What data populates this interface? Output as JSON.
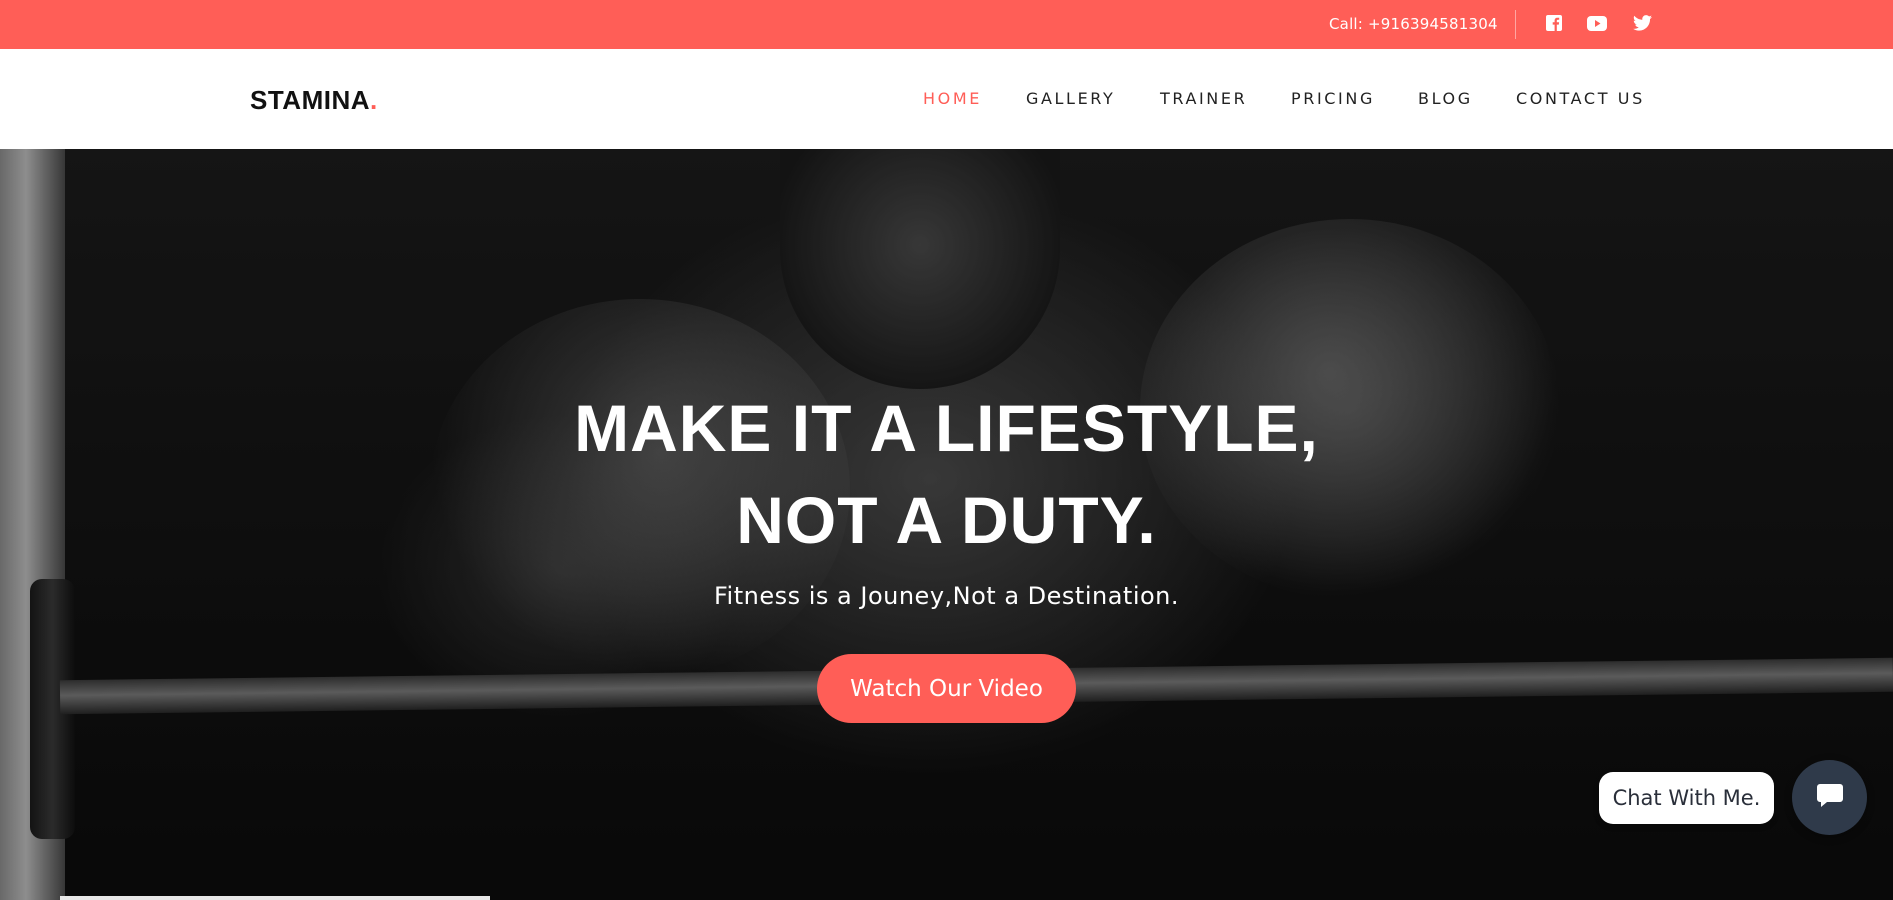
{
  "topbar": {
    "call_text": "Call: +916394581304",
    "social": [
      {
        "icon": "facebook-icon"
      },
      {
        "icon": "youtube-icon"
      },
      {
        "icon": "twitter-icon"
      }
    ],
    "background": "#ff5e57"
  },
  "header": {
    "logo_text": "STAMINA",
    "logo_dot": ".",
    "nav": [
      {
        "label": "HOME",
        "active": true
      },
      {
        "label": "GALLERY",
        "active": false
      },
      {
        "label": "TRAINER",
        "active": false
      },
      {
        "label": "PRICING",
        "active": false
      },
      {
        "label": "BLOG",
        "active": false
      },
      {
        "label": "CONTACT US",
        "active": false
      }
    ]
  },
  "hero": {
    "title_line1": "MAKE IT A LIFESTYLE,",
    "title_line2": "NOT A DUTY.",
    "subtitle": "Fitness is a Jouney,Not a Destination.",
    "cta_label": "Watch Our Video",
    "accent": "#ff5e57"
  },
  "chat": {
    "label": "Chat With Me.",
    "icon": "chat-bubble-icon",
    "button_color": "#2f3a4a"
  }
}
